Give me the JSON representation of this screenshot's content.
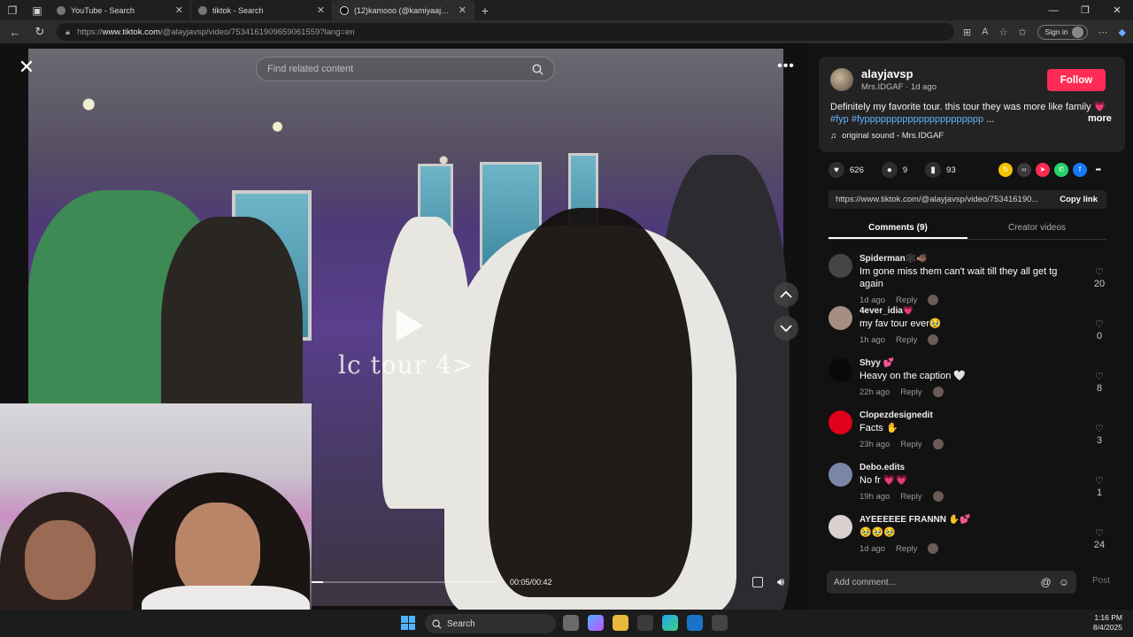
{
  "browser": {
    "tabs": [
      {
        "title": "YouTube - Search",
        "active": false,
        "color": "#777777"
      },
      {
        "title": "tiktok - Search",
        "active": false,
        "color": "#777777"
      },
      {
        "title": "(12)kamooo (@kamiyaajoness) | T",
        "active": true,
        "color": "#111111"
      }
    ],
    "address": {
      "prefix": "https://",
      "host": "www.tiktok.com",
      "path": "/@alayjavsp/video/7534161909659061559?lang=en"
    },
    "signin_label": "Sign in"
  },
  "video": {
    "search_placeholder": "Find related content",
    "overlay_text": "lc tour 4>",
    "time": "00:05/00:42",
    "progress_fraction": 0.06
  },
  "post": {
    "author": "alayjavsp",
    "author_sub": "Mrs.IDGAF · 1d ago",
    "follow_label": "Follow",
    "caption_text": "Definitely my favorite tour. this tour they was more like family ",
    "caption_heart": "💗",
    "caption_tags": "#fyp #fypppppppppppppppppppppp",
    "caption_ellipsis": " ...",
    "more_label": "more",
    "sound": "original sound - Mrs.IDGAF",
    "likes": "626",
    "comments_count": "9",
    "saves": "93",
    "share_url": "https://www.tiktok.com/@alayjavsp/video/753416190...",
    "copy_label": "Copy link",
    "tab_comments": "Comments (9)",
    "tab_creator": "Creator videos"
  },
  "comments": [
    {
      "user": "Spiderman🕸️🐗",
      "text": "Im gone miss them can't wait till they all get tg again",
      "time": "1d ago",
      "reply": "Reply",
      "likes": "20",
      "avatar_color": "#444444"
    },
    {
      "user": "4ever_idia💗",
      "text": "my fav tour ever🥹",
      "time": "1h ago",
      "reply": "Reply",
      "likes": "0",
      "avatar_color": "#a58f82"
    },
    {
      "user": "Shyy 💕",
      "text": "Heavy on the caption 🤍",
      "time": "22h ago",
      "reply": "Reply",
      "likes": "8",
      "avatar_color": "#0a0a0a"
    },
    {
      "user": "Clopezdesignedit",
      "text": "Facts ✋",
      "time": "23h ago",
      "reply": "Reply",
      "likes": "3",
      "avatar_color": "#e0001b"
    },
    {
      "user": "Debo.edits",
      "text": "No fr 💗💗",
      "time": "19h ago",
      "reply": "Reply",
      "likes": "1",
      "avatar_color": "#7a86a6"
    },
    {
      "user": "AYEEEEEE FRANNN ✋💕",
      "text": "🥹🥹🥹",
      "time": "1d ago",
      "reply": "Reply",
      "likes": "24",
      "avatar_color": "#d9d0cf"
    }
  ],
  "composer": {
    "placeholder": "Add comment...",
    "post_label": "Post"
  },
  "taskbar": {
    "search_label": "Search",
    "time": "1:16 PM",
    "date": "8/4/2025"
  },
  "colors": {
    "accent": "#fe2c55",
    "link": "#63b4ff",
    "panel": "#121212"
  }
}
